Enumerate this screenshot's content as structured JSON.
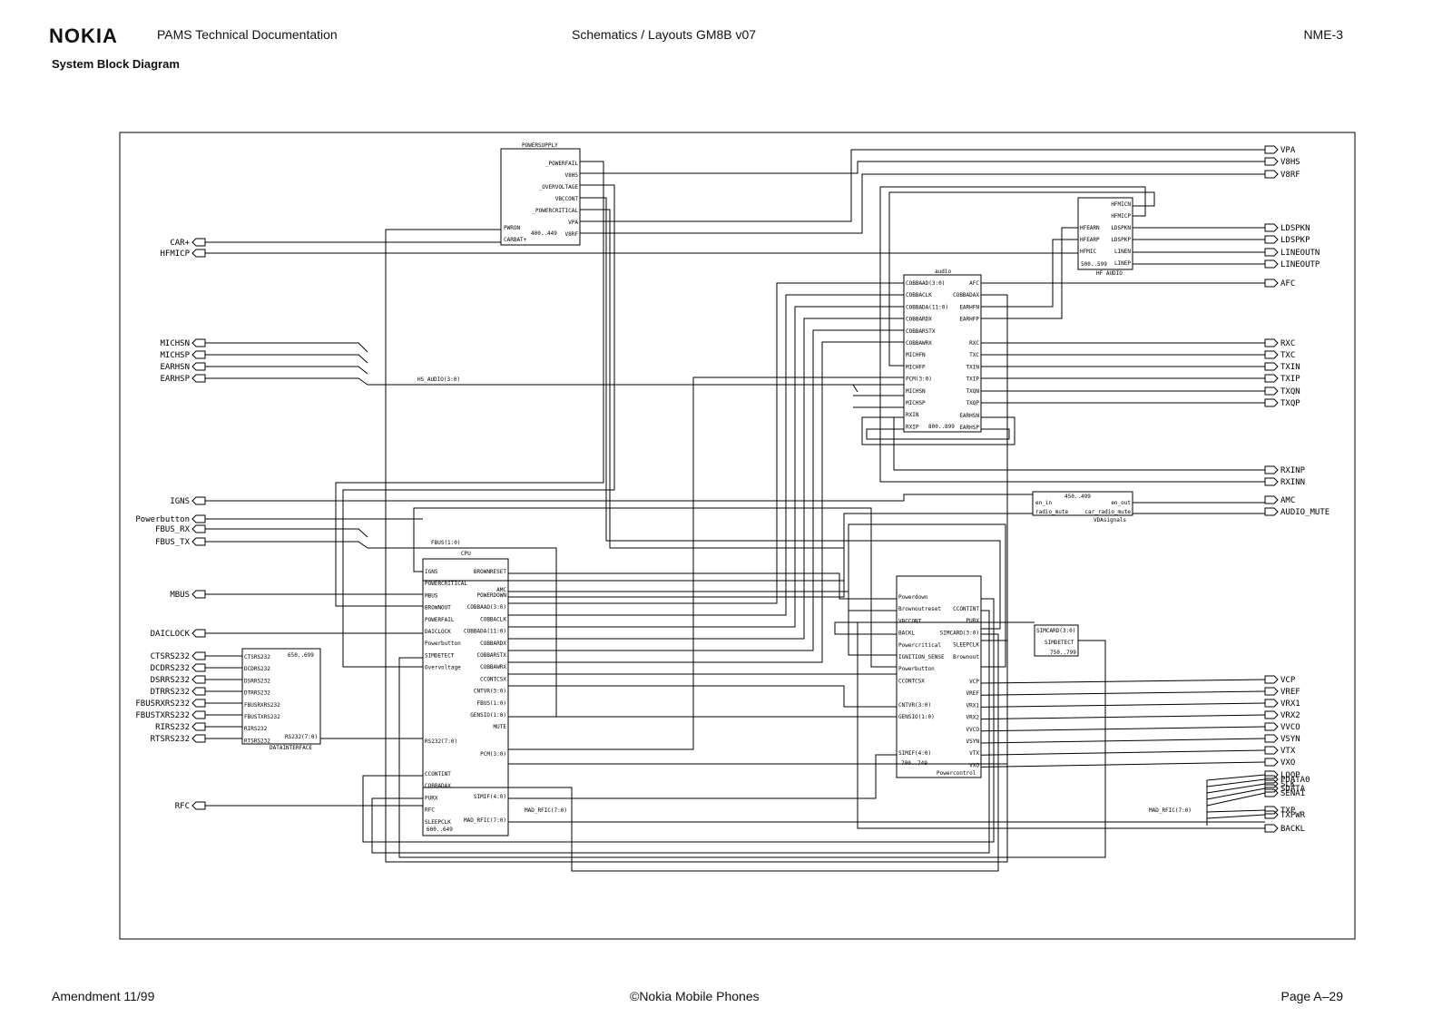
{
  "header": {
    "brand": "NOKIA",
    "doc_title": "PAMS Technical Documentation",
    "center_title": "Schematics / Layouts GM8B v07",
    "model": "NME-3",
    "subtitle": "System Block Diagram"
  },
  "footer": {
    "amendment": "Amendment 11/99",
    "copyright": "©Nokia Mobile Phones",
    "page": "Page A–29"
  },
  "blocks": {
    "powersupply": {
      "title": "POWERSUPPLY",
      "range": "400..449",
      "inputs": [
        "PWRON",
        "CARBAT+"
      ],
      "outputs": [
        "_POWERFAIL",
        "V8HS",
        "_OVERVOLTAGE",
        "VBCCONT",
        "_POWERCRITICAL",
        "VPA",
        "V8RF"
      ]
    },
    "audio": {
      "title": "audio",
      "range": "800..899",
      "inputs": [
        "COBBAAD(3:0)",
        "COBBACLK",
        "COBBADA(11:0)",
        "COBBARDX",
        "COBBARSTX",
        "COBBAWRX",
        "MICHFN",
        "MICHFP",
        "PCM(3:0)",
        "MICHSN",
        "MICHSP",
        "RXIN",
        "RXIP"
      ],
      "outputs": [
        "AFC",
        "COBBADAX",
        "EARHFN",
        "EARHFP",
        "RXC",
        "TXC",
        "TXIN",
        "TXIP",
        "TXQN",
        "TXQP",
        "EARHSN",
        "EARHSP"
      ]
    },
    "hf_audio": {
      "title": "HF AUDIO",
      "range": "500..599",
      "right": [
        "HFMICN",
        "HFMICP",
        "LDSPKN",
        "LDSPKP",
        "LINEN",
        "LINEP"
      ],
      "left": [
        "HFEARN",
        "HFEARP",
        "HFMIC"
      ]
    },
    "cpu": {
      "title": "CPU",
      "range": "600..649",
      "inputs": [
        "IGNS",
        "POWERCRITICAL",
        "MBUS",
        "BROWNOUT",
        "POWERFAIL",
        "DAICLOCK",
        "Powerbutton",
        "SIMDETECT",
        "Overvoltage",
        "RS232(7:0)",
        "CCONTINT",
        "COBBADAX",
        "PURX",
        "RFC",
        "SLEEPCLK"
      ],
      "outputs": [
        "BROWNRESET",
        "AMC",
        "POWERDOWN",
        "COBBAAD(3:0)",
        "COBBACLK",
        "COBBADA(11:0)",
        "COBBARDX",
        "COBBARSTX",
        "COBBAWRX",
        "CCONTCSX",
        "CNTVR(3:0)",
        "FBUS(1:0)",
        "GENSIO(1:0)",
        "MUTE",
        "PCM(3:0)",
        "SIMIF(4:0)",
        "MAD_RFIC(7:0)"
      ]
    },
    "powercontrol": {
      "title": "Powercontrol",
      "range": "700..749",
      "inputs": [
        "Powerdown",
        "Brownoutreset",
        "VBCCONT",
        "BACKL",
        "Powercritical",
        "IGNITION_SENSE",
        "Powerbutton",
        "CCONTCSX",
        "CNTVR(3:0)",
        "GENSIO(1:0)",
        "SIMIF(4:0)"
      ],
      "outputs": [
        "CCONTINT",
        "PURX",
        "SIMCARD(3:0)",
        "SLEEPCLK",
        "Brownout",
        "VCP",
        "VREF",
        "VRX1",
        "VRX2",
        "VVCO",
        "VSYN",
        "VTX",
        "VXO"
      ]
    },
    "vdasignals": {
      "title": "VDAsignals",
      "range": "450..499",
      "left": [
        "en_in",
        "radio_mute"
      ],
      "right": [
        "en_out",
        "car_radio_mute"
      ]
    },
    "simcard": {
      "title": "SIMCARD(3:0)",
      "sub": "SIMDETECT",
      "range": "750..799"
    },
    "datainterface": {
      "title": "DATAINTERFACE",
      "range": "650..699",
      "inputs": [
        "CTSRS232",
        "DCDRS232",
        "DSRRS232",
        "DTRRS232",
        "FBUSRXRS232",
        "FBUSTXRS232",
        "RIRS232",
        "RTSRS232"
      ],
      "output": "RS232(7:0)"
    }
  },
  "ports_left": [
    "CAR+",
    "HFMICP",
    "MICHSN",
    "MICHSP",
    "EARHSN",
    "EARHSP",
    "IGNS",
    "Powerbutton",
    "FBUS_RX",
    "FBUS_TX",
    "MBUS",
    "DAICLOCK",
    "CTSRS232",
    "DCDRS232",
    "DSRRS232",
    "DTRRS232",
    "FBUSRXRS232",
    "FBUSTXRS232",
    "RIRS232",
    "RTSRS232",
    "RFC"
  ],
  "ports_right": [
    "VPA",
    "V8HS",
    "V8RF",
    "LDSPKN",
    "LDSPKP",
    "LINEOUTN",
    "LINEOUTP",
    "AFC",
    "RXC",
    "TXC",
    "TXIN",
    "TXIP",
    "TXQN",
    "TXQP",
    "RXINP",
    "RXINN",
    "AMC",
    "AUDIO_MUTE",
    "VCP",
    "VREF",
    "VRX1",
    "VRX2",
    "VVCO",
    "VSYN",
    "VTX",
    "VXO",
    "LOOP",
    "PDATA0",
    "SLK",
    "SDATA",
    "SENA1",
    "TXP",
    "TXPWR",
    "BACKL"
  ],
  "bus_labels": {
    "hs_audio": "HS_AUDIO(3:0)",
    "fbus": "FBUS(1:0)",
    "mad_rfic_cpu": "MAD_RFIC(7:0)",
    "mad_rfic_right": "MAD_RFIC(7:0)"
  }
}
